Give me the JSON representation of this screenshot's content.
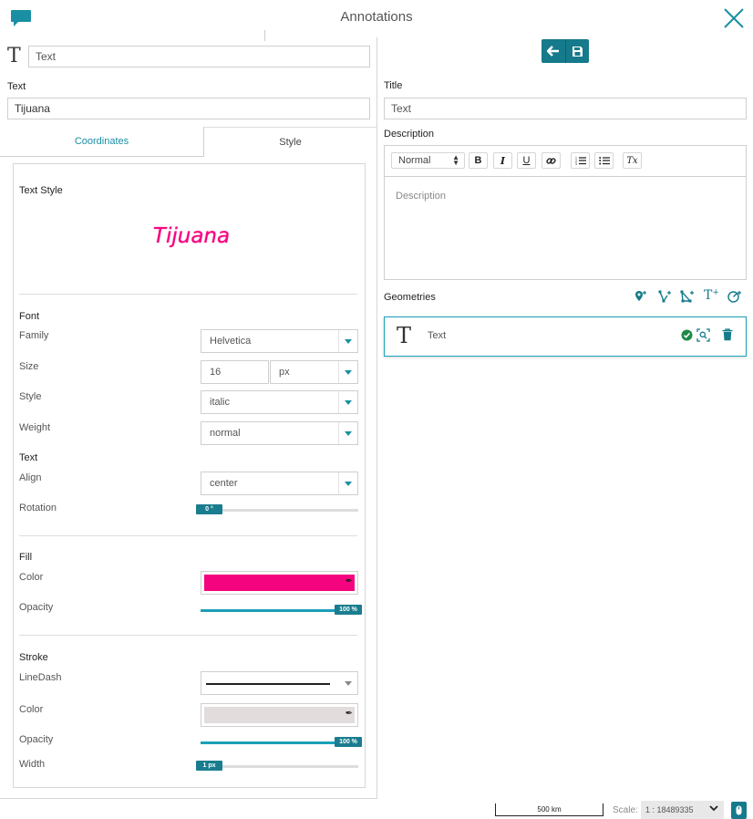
{
  "header": {
    "title": "Annotations"
  },
  "left": {
    "symbol_field": {
      "value": "Text"
    },
    "text_label": "Text",
    "text_value": "Tijuana",
    "tabs": [
      {
        "label": "Coordinates"
      },
      {
        "label": "Style"
      }
    ],
    "style": {
      "text_style_heading": "Text Style",
      "preview_text": "Tijuana",
      "font_heading": "Font",
      "family_label": "Family",
      "family_value": "Helvetica",
      "size_label": "Size",
      "size_value": "16",
      "size_unit": "px",
      "style_label": "Style",
      "style_value": "italic",
      "weight_label": "Weight",
      "weight_value": "normal",
      "text_heading": "Text",
      "align_label": "Align",
      "align_value": "center",
      "rotation_label": "Rotation",
      "rotation_value": "0 °",
      "fill_heading": "Fill",
      "fill_color_label": "Color",
      "fill_color": "#f5047f",
      "fill_opacity_label": "Opacity",
      "fill_opacity_value": "100 %",
      "fill_opacity_fraction": 1.0,
      "stroke_heading": "Stroke",
      "linedash_label": "LineDash",
      "stroke_color_label": "Color",
      "stroke_color": "#e2dcdd",
      "stroke_opacity_label": "Opacity",
      "stroke_opacity_value": "100 %",
      "stroke_opacity_fraction": 1.0,
      "width_label": "Width",
      "width_value": "1 px"
    }
  },
  "right": {
    "title_label": "Title",
    "title_value": "Text",
    "description_label": "Description",
    "editor": {
      "format_value": "Normal",
      "bold": "B",
      "italic": "I",
      "underline": "U",
      "clear": "Tx",
      "placeholder": "Description"
    },
    "geometries_label": "Geometries",
    "geometry_item": {
      "symbol": "T",
      "label": "Text"
    }
  },
  "footer": {
    "scale_bar_label": "500 km",
    "scale_label": "Scale:",
    "scale_value": "1 : 18489335"
  },
  "colors": {
    "accent": "#1a8fa3",
    "accent_dark": "#157a8b",
    "preview_text": "#f5047f"
  }
}
